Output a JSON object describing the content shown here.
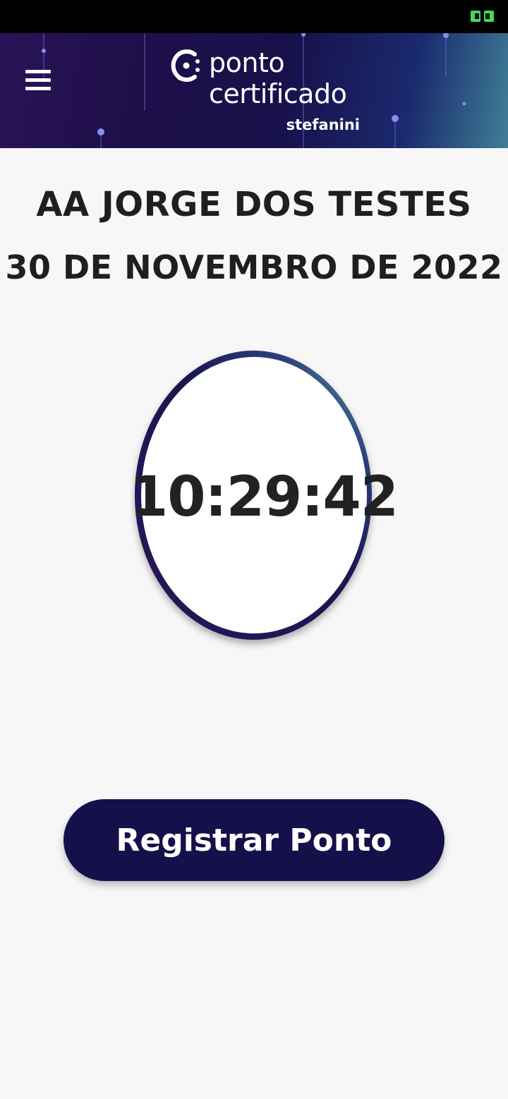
{
  "header": {
    "logo_line1": "ponto",
    "logo_line2": "certificado",
    "logo_sub": "stefanini"
  },
  "main": {
    "user_name": "AA JORGE DOS TESTES",
    "date": "30 DE NOVEMBRO DE 2022",
    "clock_time": "10:29:42",
    "register_button_label": "Registrar Ponto"
  },
  "icons": {
    "menu": "hamburger-menu-icon",
    "battery": "battery-icon",
    "logo": "ponto-certificado-logo-mark"
  },
  "colors": {
    "primary": "#15104a",
    "battery": "#3ddc5a",
    "background": "#f7f7f7",
    "ring_accent": "#5fb8a8"
  }
}
